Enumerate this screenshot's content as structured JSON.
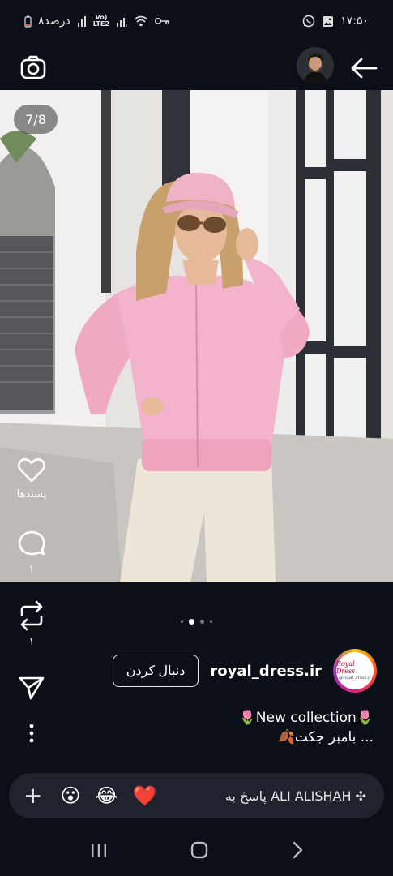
{
  "status_bar": {
    "time": "۱۷:۵۰",
    "battery": "۸درصد",
    "network_top": "Vo)",
    "network_bottom": "LTE2"
  },
  "post": {
    "image_counter": "7/8",
    "likes_label": "پسندها",
    "comments_count": "۱",
    "reposts_count": "۱",
    "carousel_dots": 4,
    "active_dot": 1
  },
  "author": {
    "username": "royal_dress.ir",
    "follow_label": "دنبال کردن",
    "logo_top": "Royal Dress",
    "logo_bottom": "@royal_dress.ir"
  },
  "caption": {
    "line1": "🌷New collection🌷",
    "line2": "🍂بامبر جکت ..."
  },
  "reply": {
    "placeholder": "پاسخ به ALI ALISHAH ✣",
    "emojis": [
      "😮",
      "😂",
      "❤️"
    ]
  },
  "colors": {
    "background": "#0b0f17",
    "reply_bg": "#1e232d",
    "jacket": "#f4b3cc"
  }
}
